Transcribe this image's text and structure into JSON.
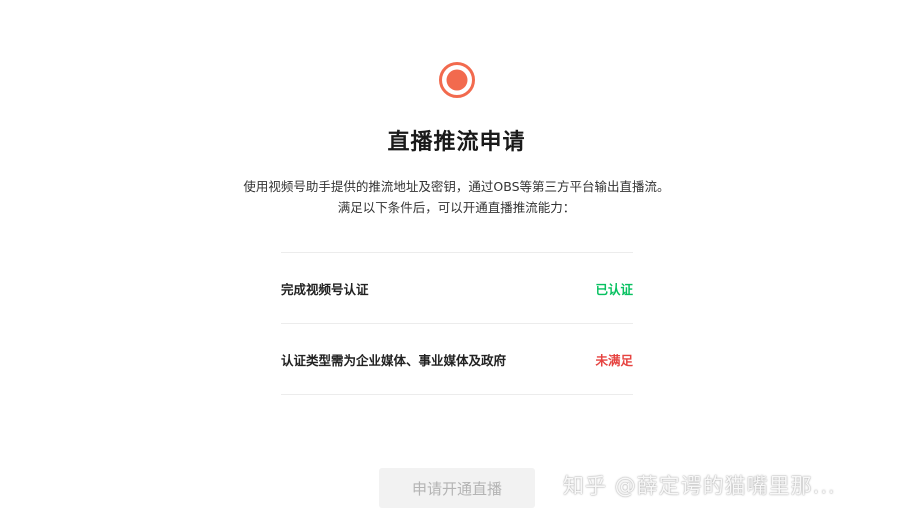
{
  "header": {
    "title": "直播推流申请",
    "description_line1": "使用视频号助手提供的推流地址及密钥，通过OBS等第三方平台输出直播流。",
    "description_line2": "满足以下条件后，可以开通直播推流能力："
  },
  "icon": {
    "name": "live-record-icon",
    "ring_color": "#f26a4e",
    "dot_color": "#f26a4e"
  },
  "requirements": [
    {
      "label": "完成视频号认证",
      "status": "已认证",
      "status_color": "#07c160"
    },
    {
      "label": "认证类型需为企业媒体、事业媒体及政府",
      "status": "未满足",
      "status_color": "#e64340"
    }
  ],
  "actions": {
    "apply_label": "申请开通直播",
    "apply_enabled": false
  },
  "watermark": {
    "text": "知乎 @薛定谔的猫嘴里那..."
  }
}
